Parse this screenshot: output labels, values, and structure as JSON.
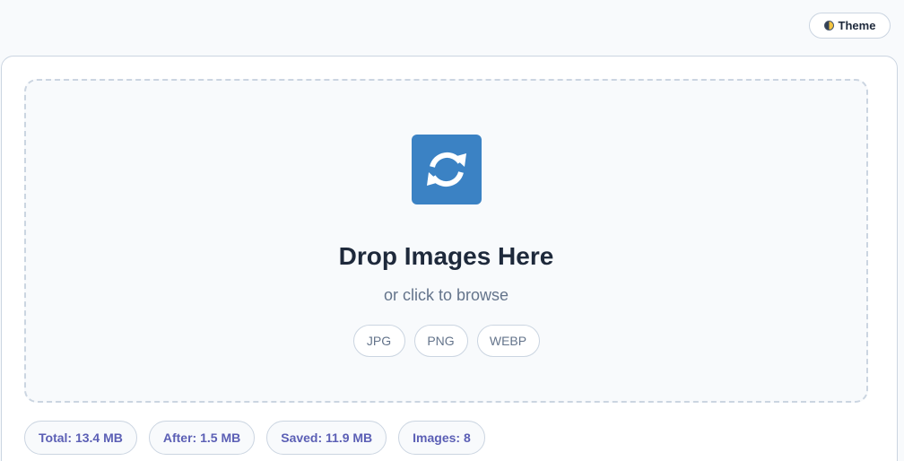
{
  "header": {
    "theme_label": "Theme"
  },
  "dropzone": {
    "icon": "refresh-icon",
    "title": "Drop Images Here",
    "subtitle": "or click to browse",
    "formats": [
      "JPG",
      "PNG",
      "WEBP"
    ]
  },
  "stats": {
    "total": "Total: 13.4 MB",
    "after": "After: 1.5 MB",
    "saved": "Saved: 11.9 MB",
    "images": "Images: 8"
  },
  "colors": {
    "accent": "#3b82c4",
    "stat_text": "#5b5fb5",
    "title": "#1e293b"
  }
}
